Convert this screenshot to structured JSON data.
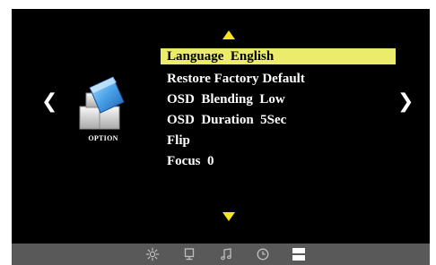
{
  "menu": {
    "items": [
      {
        "label": "Language  English",
        "selected": true
      },
      {
        "label": "Restore Factory Default",
        "selected": false
      },
      {
        "label": "OSD  Blending  Low",
        "selected": false
      },
      {
        "label": "OSD  Duration  5Sec",
        "selected": false
      },
      {
        "label": "Flip",
        "selected": false
      },
      {
        "label": "Focus  0",
        "selected": false
      }
    ]
  },
  "navigation": {
    "left_arrow": "❮",
    "right_arrow": "❯"
  },
  "category": {
    "label": "OPTION",
    "icon": "option-blocks-icon"
  },
  "bottom_bar": {
    "icons": [
      "picture-brightness-icon",
      "monitor-icon",
      "music-note-icon",
      "clock-icon",
      "option-icon"
    ],
    "active_index": 4
  },
  "colors": {
    "selection_highlight": "#ecec6c",
    "scroll_arrows": "#f5e51c",
    "background": "#000000",
    "bottom_bar": "#595959"
  }
}
